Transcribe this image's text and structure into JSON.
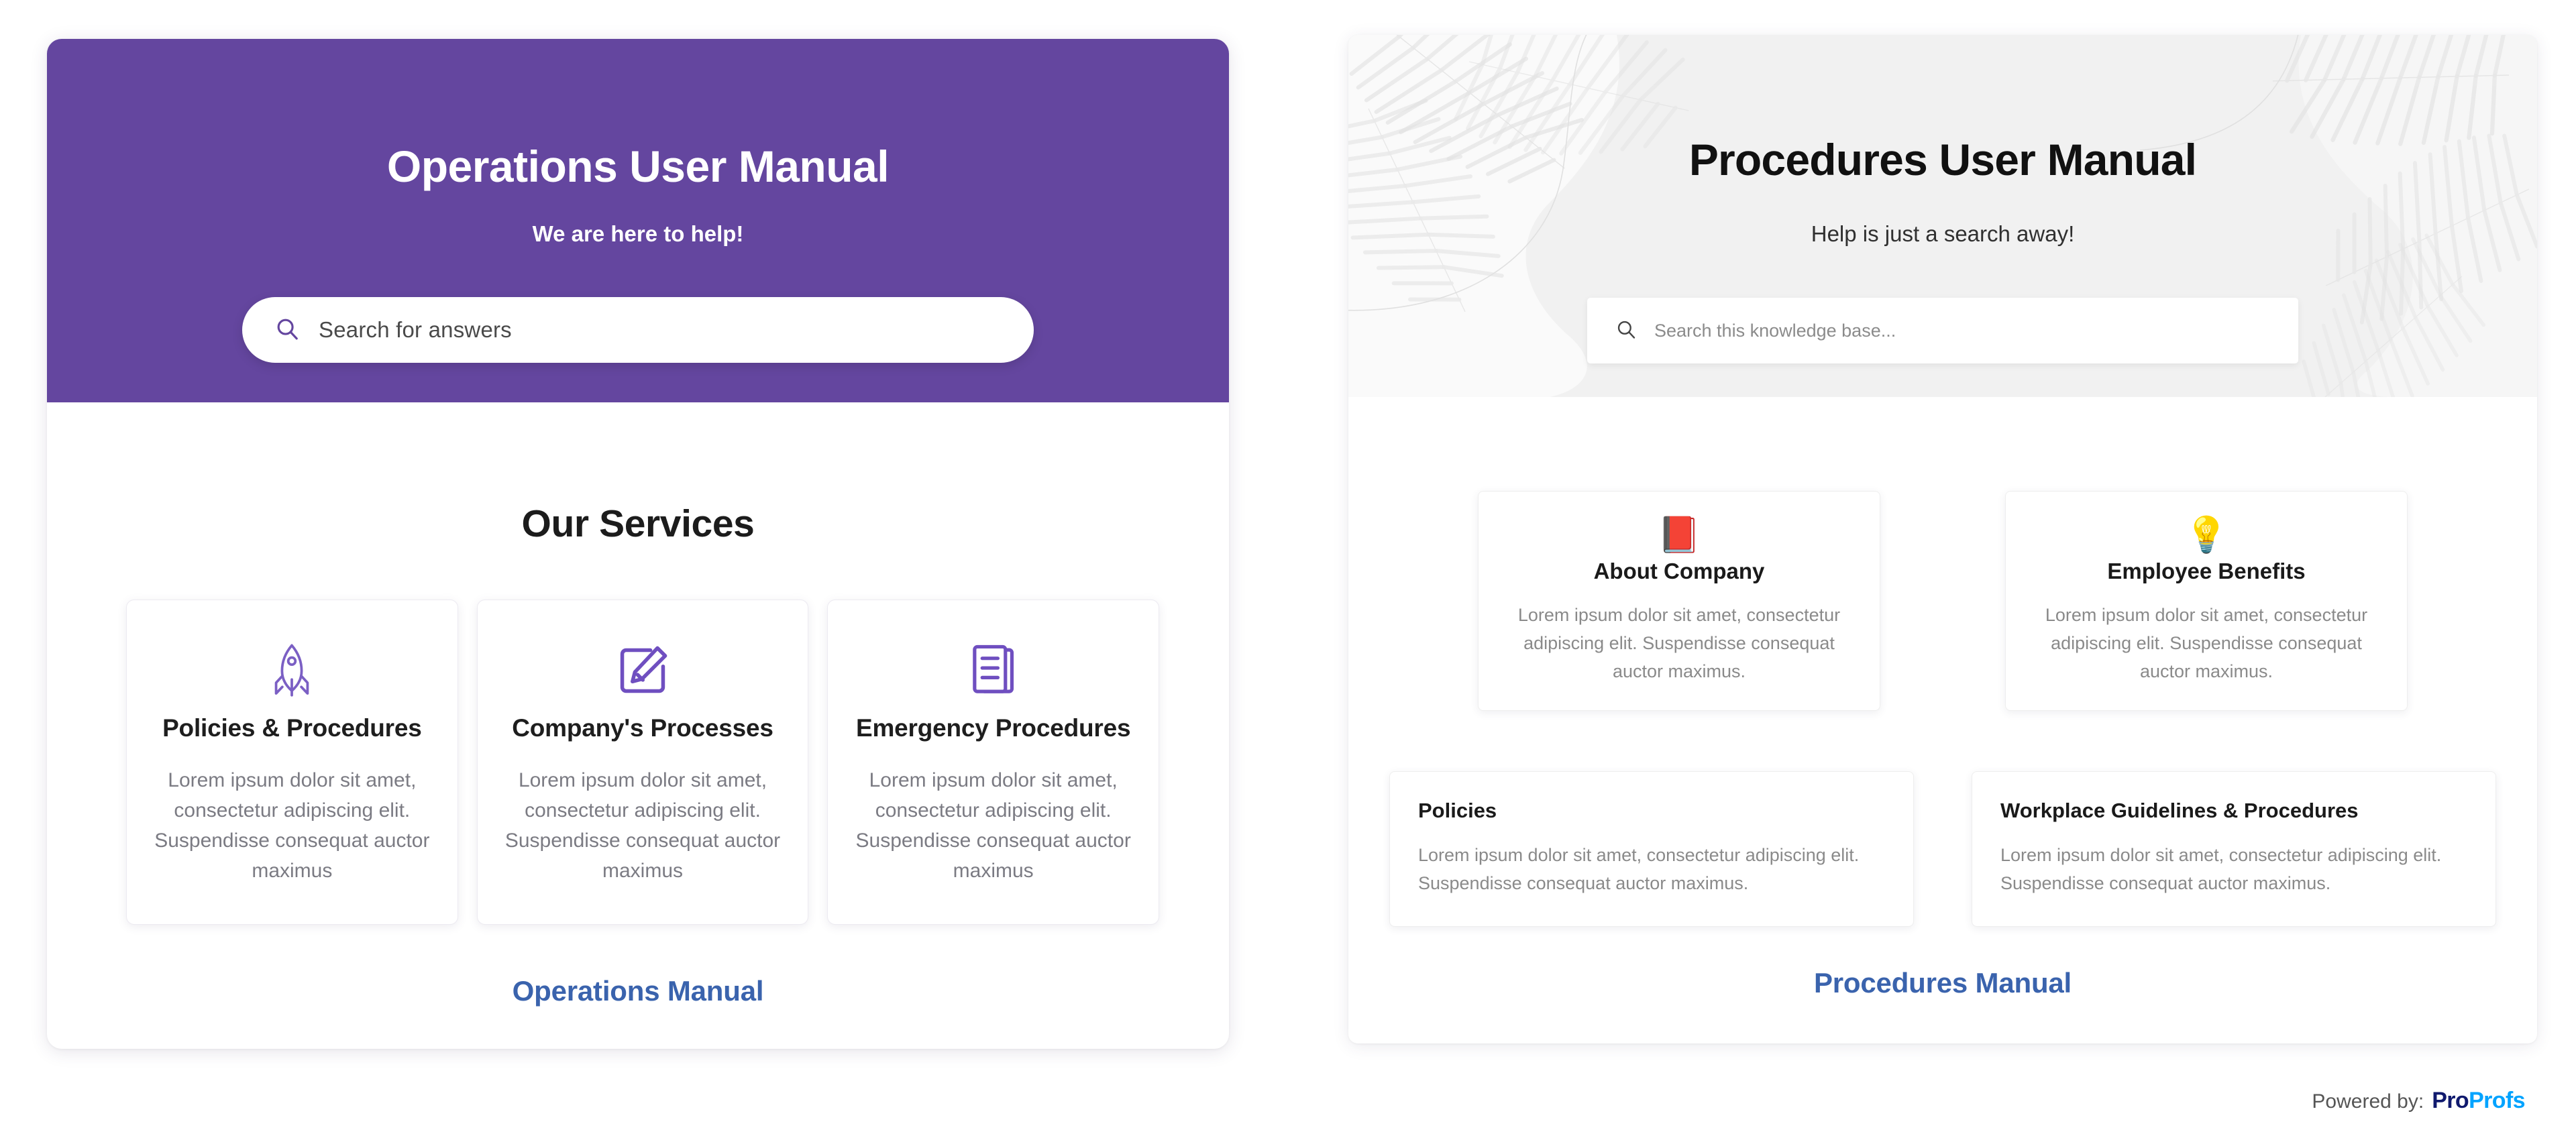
{
  "left_panel": {
    "hero": {
      "title": "Operations User Manual",
      "subtitle": "We are here to help!",
      "accent_color": "#64469f",
      "search": {
        "icon": "search-icon",
        "placeholder": "Search for answers",
        "value": ""
      }
    },
    "services_heading": "Our Services",
    "cards": [
      {
        "icon": "rocket-icon",
        "title": "Policies & Procedures",
        "description": "Lorem ipsum dolor sit amet, consectetur adipiscing elit. Suspendisse consequat auctor maximus"
      },
      {
        "icon": "edit-pencil-square-icon",
        "title": "Company's Processes",
        "description": "Lorem ipsum dolor sit amet, consectetur adipiscing elit. Suspendisse consequat auctor maximus"
      },
      {
        "icon": "documents-stack-icon",
        "title": "Emergency Procedures",
        "description": "Lorem ipsum dolor sit amet, consectetur adipiscing elit. Suspendisse consequat auctor maximus"
      }
    ],
    "manual_link": "Operations Manual",
    "link_color": "#3a63ad"
  },
  "right_panel": {
    "hero": {
      "title": "Procedures User Manual",
      "subtitle": "Help is just a search away!",
      "background_color": "#f1f1f1",
      "decoration": "palm-leaf-pattern",
      "search": {
        "icon": "search-icon",
        "placeholder": "Search this knowledge base...",
        "value": ""
      }
    },
    "top_cards": [
      {
        "icon": "closed-book-emoji",
        "glyph": "📕",
        "title": "About Company",
        "description": "Lorem ipsum dolor sit amet, consectetur adipiscing elit. Suspendisse consequat auctor maximus."
      },
      {
        "icon": "light-bulb-emoji",
        "glyph": "💡",
        "title": "Employee Benefits",
        "description": "Lorem ipsum dolor sit amet, consectetur adipiscing elit. Suspendisse consequat auctor maximus."
      }
    ],
    "bottom_cards": [
      {
        "title": "Policies",
        "description": "Lorem ipsum dolor sit amet, consectetur adipiscing elit. Suspendisse consequat auctor maximus."
      },
      {
        "title": "Workplace Guidelines & Procedures",
        "description": "Lorem ipsum dolor sit amet, consectetur adipiscing elit. Suspendisse consequat auctor maximus."
      }
    ],
    "manual_link": "Procedures Manual",
    "link_color": "#3a63ad"
  },
  "footer": {
    "powered_label": "Powered by:",
    "brand_part_1": "Pro",
    "brand_part_2": "Profs",
    "brand_color_1": "#101a6e",
    "brand_color_2": "#00a3ff"
  }
}
